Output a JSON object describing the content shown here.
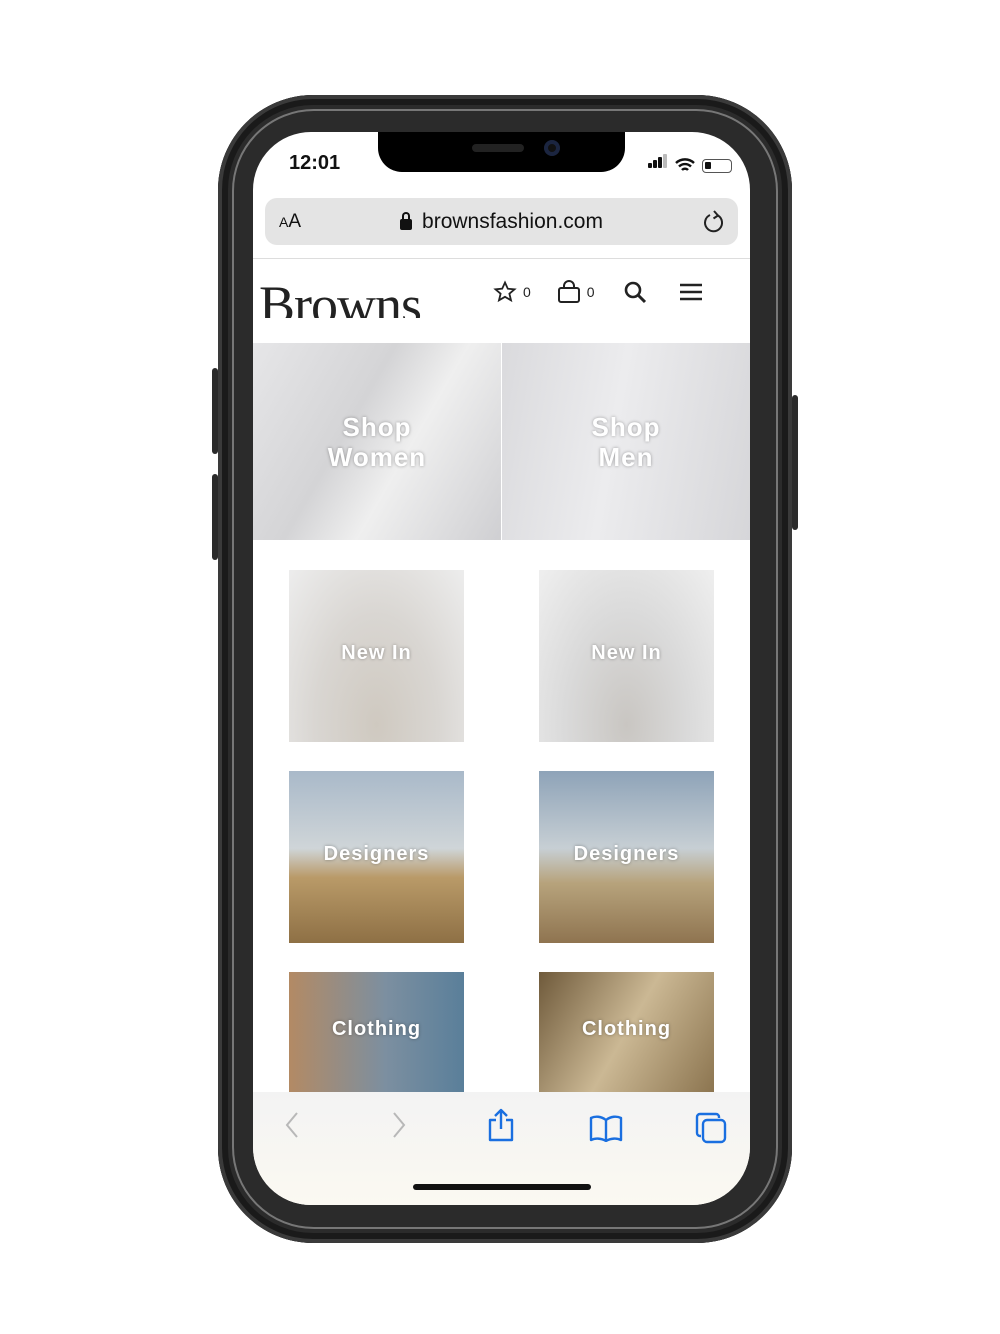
{
  "status_bar": {
    "time": "12:01"
  },
  "browser": {
    "text_size_label": "AA",
    "url": "brownsfashion.com"
  },
  "header": {
    "logo": "Browns",
    "wishlist_count": "0",
    "bag_count": "0"
  },
  "hero": [
    {
      "label_line1": "Shop",
      "label_line2": "Women"
    },
    {
      "label_line1": "Shop",
      "label_line2": "Men"
    }
  ],
  "tiles": [
    {
      "label": "New In"
    },
    {
      "label": "New In"
    },
    {
      "label": "Designers"
    },
    {
      "label": "Designers"
    },
    {
      "label": "Clothing"
    },
    {
      "label": "Clothing"
    }
  ],
  "colors": {
    "accent": "#1a6fe0",
    "inactive": "#b8b8b8"
  },
  "toolbar": {
    "icons": [
      "back-icon",
      "forward-icon",
      "share-icon",
      "bookmarks-icon",
      "tabs-icon"
    ]
  }
}
